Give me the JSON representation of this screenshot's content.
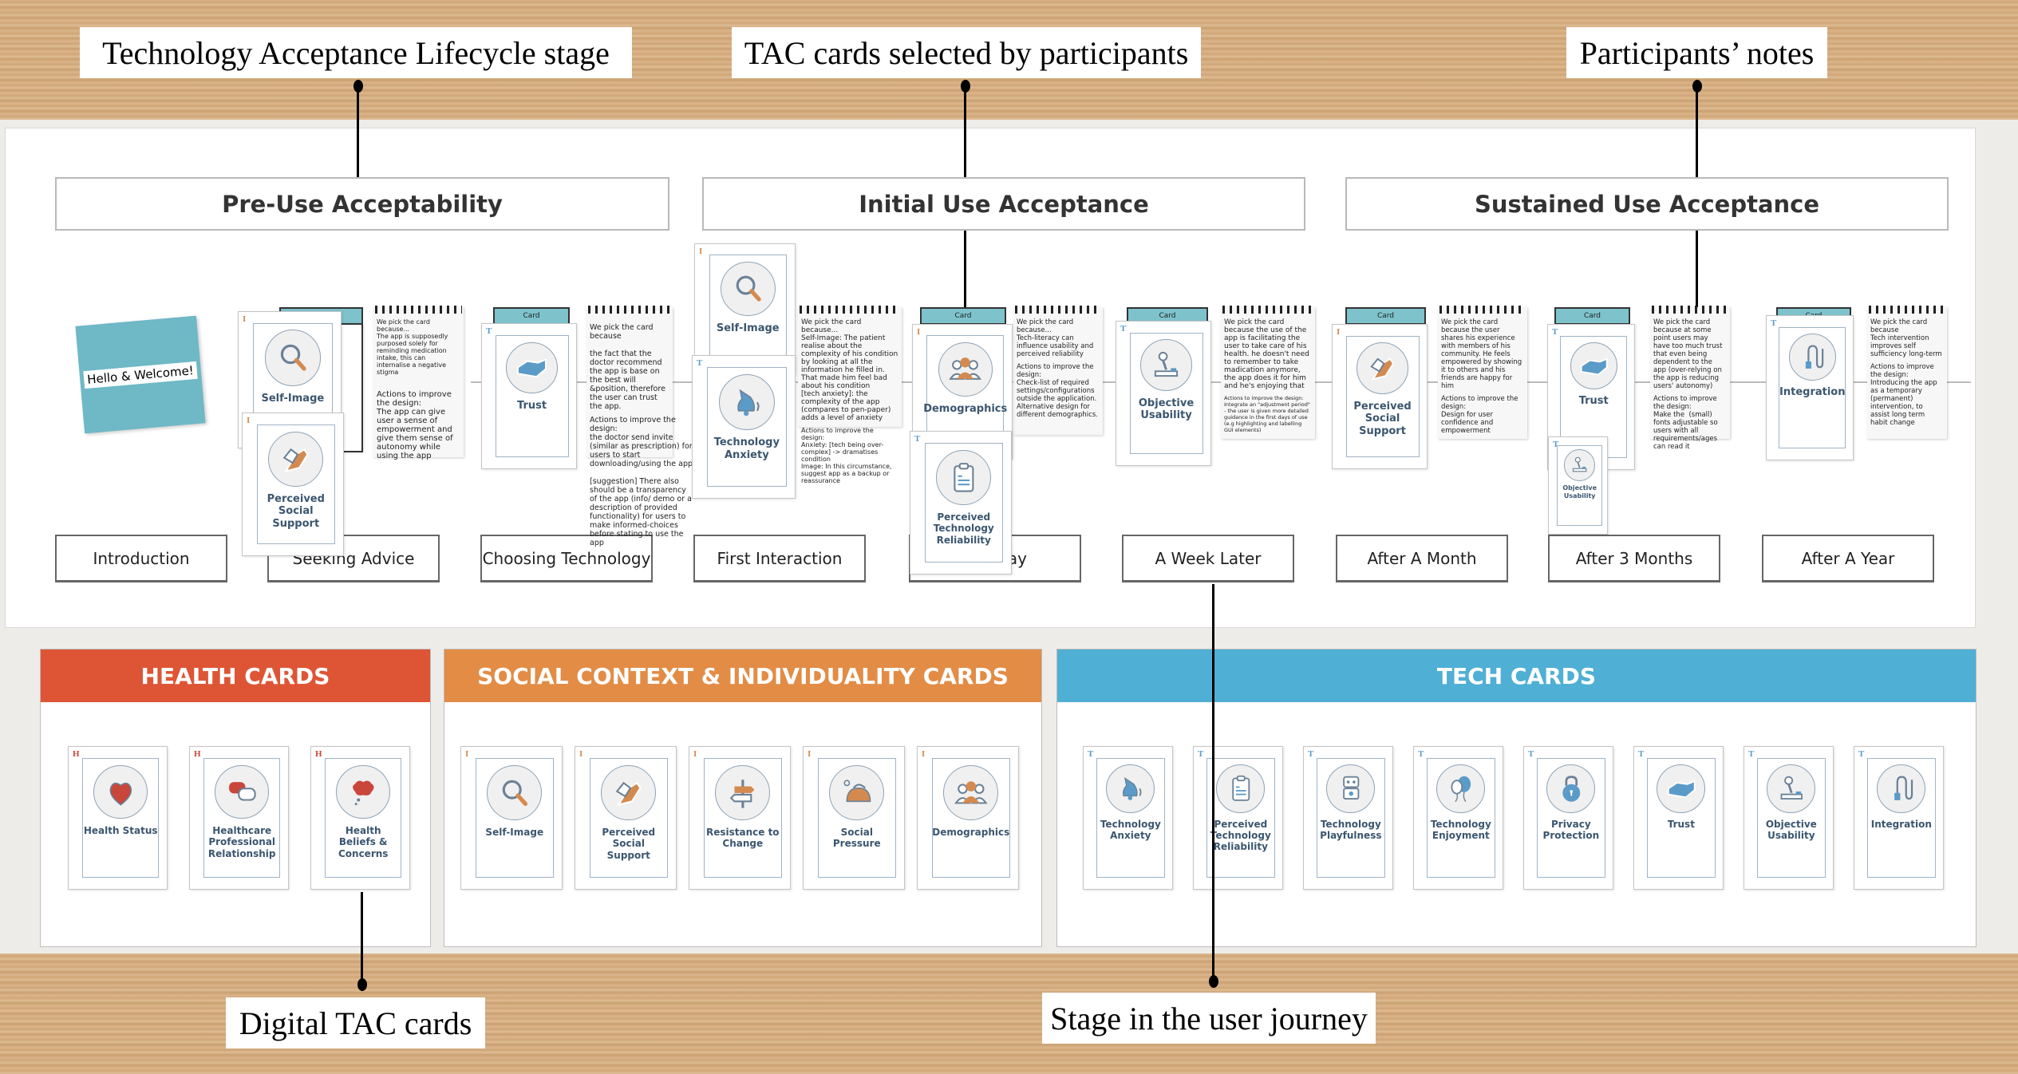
{
  "annotations": {
    "tal_stage": "Technology Acceptance Lifecycle stage",
    "tac_selected": "TAC cards selected by participants",
    "participant_notes": "Participants’ notes",
    "digital_cards": "Digital TAC cards",
    "user_journey": "Stage in the user journey"
  },
  "phases": [
    "Pre-Use Acceptability",
    "Initial Use Acceptance",
    "Sustained Use Acceptance"
  ],
  "welcome": "Hello & Welcome!",
  "card_tab_label": "Card",
  "stages": [
    "Introduction",
    "Seeking Advice",
    "Choosing Technology",
    "First Interaction",
    "ay",
    "A Week Later",
    "After A Month",
    "After 3 Months",
    "After A Year"
  ],
  "board_cards": [
    {
      "title": "Self-Image",
      "letter": "I"
    },
    {
      "title": "Perceived Social Support",
      "letter": "I"
    },
    {
      "title": "Trust",
      "letter": "T"
    },
    {
      "title": "Self-Image",
      "letter": "I"
    },
    {
      "title": "Technology Anxiety",
      "letter": "T"
    },
    {
      "title": "Demographics",
      "letter": "I"
    },
    {
      "title": "Perceived Technology Reliability",
      "letter": "T"
    },
    {
      "title": "Objective Usability",
      "letter": "T"
    },
    {
      "title": "Perceived Social Support",
      "letter": "I"
    },
    {
      "title": "Trust",
      "letter": "T"
    },
    {
      "title": "Objective Usability",
      "letter": "T"
    },
    {
      "title": "Integration",
      "letter": "T"
    }
  ],
  "notes": [
    {
      "reason": "We pick the card because...\nThe app is supposedly purposed solely for reminding medication intake, this can internalise a negative stigma",
      "actions": "Actions to improve the design:\nThe app can give user a sense of empowerment and give them sense of autonomy while using the app"
    },
    {
      "reason": "We pick the card because\n\nthe fact that the doctor recommend the app is base on the best will &position, therefore the user can trust the app.",
      "actions": "Actions to improve the design:\nthe doctor send invite (similar as prescription) for users to start downloading/using the app\n\n[suggestion] There also should be a transparency of the app (info/ demo or a description of provided functionality) for users to make informed-choices before stating to use the app"
    },
    {
      "reason": "We pick the card because...\nSelf-Image: The patient realise about the complexity of his condition by looking at all the information he filled in. That made him feel bad about his condition\n[tech anxiety]: the complexity of the app (compares to pen-paper) adds a level of anxiety",
      "actions": "Actions to improve the design:\nAnxiety: [tech being over-complex] -> dramatises condition\nImage: In this circumstance, suggest app as a backup or reassurance"
    },
    {
      "reason": "We pick the card because...\nTech-literacy can influence usability and perceived reliability",
      "actions": "Actions to improve the design:\nCheck-list of required settings/configurations outside the application.\nAlternative design for different demographics."
    },
    {
      "reason": "We pick the card because the use of the app is facilitating the user to take care of his health. he doesn't need to remember to take madication anymore, the app does it for him and he's enjoying that",
      "actions": "Actions to improve the design:\nIntegrate an \"adjustment period\" - the user is given more detailed guidance in the first days of use (e.g highlighting and labelling GUI elements)"
    },
    {
      "reason": "We pick the card because the user shares his experience with members of his community. He feels empowered by showing it to others and his friends are happy for him",
      "actions": "Actions to improve the design:\nDesign for user confidence and empowerment"
    },
    {
      "reason": "We pick the card because at some point users may have too much trust that even being dependent to the app (over-relying on the app is reducing users' autonomy)",
      "actions": "Actions to improve the design:\nMake the  (small) fonts adjustable so users with all requirements/ages can read it"
    },
    {
      "reason": "We pick the card because\nTech intervention improves self sufficiency long-term",
      "actions": "Actions to improve the design:\nIntroducing the app as a temporary (permanent) intervention, to assist long term habit change"
    }
  ],
  "categories": [
    {
      "title": "HEALTH CARDS",
      "color": "#de5536",
      "letter": "H",
      "icon_color": "#c8473a",
      "cards": [
        "Health Status",
        "Healthcare Professional Relationship",
        "Health Beliefs & Concerns"
      ]
    },
    {
      "title": "SOCIAL CONTEXT & INDIVIDUALITY CARDS",
      "color": "#e38c45",
      "letter": "I",
      "icon_color": "#d48a4f",
      "cards": [
        "Self-Image",
        "Perceived Social Support",
        "Resistance to Change",
        "Social Pressure",
        "Demographics"
      ]
    },
    {
      "title": "TECH CARDS",
      "color": "#4fafd4",
      "letter": "T",
      "icon_color": "#5b9bc8",
      "cards": [
        "Technology Anxiety",
        "Perceived Technology Reliability",
        "Technology Playfulness",
        "Technology Enjoyment",
        "Privacy Protection",
        "Trust",
        "Objective Usability",
        "Integration"
      ]
    }
  ],
  "colors": {
    "teal_tab": "#7ec3cc",
    "card_title": "#3b5670",
    "health": "#de5536",
    "social": "#e38c45",
    "tech": "#4fafd4"
  }
}
